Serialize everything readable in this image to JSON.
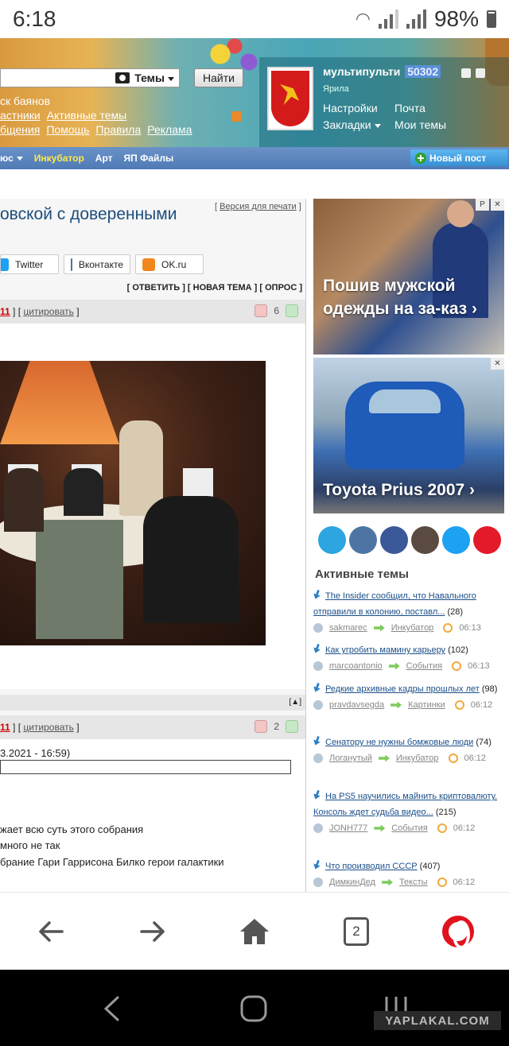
{
  "status_bar": {
    "time": "6:18",
    "battery": "98%"
  },
  "header": {
    "search": {
      "scope": "Темы",
      "button": "Найти"
    },
    "links_line1": "ск баянов",
    "links_line2": [
      "астники",
      "Активные темы"
    ],
    "links_line3": [
      "бщения",
      "Помощь",
      "Правила",
      "Реклама"
    ],
    "user": {
      "name": "мультипульти",
      "count": "50302",
      "rank": "Ярила",
      "links": {
        "settings": "Настройки",
        "mail": "Почта",
        "bookmarks": "Закладки",
        "my_topics": "Мои темы"
      }
    }
  },
  "nav": {
    "items": [
      "юс",
      "Инкубатор",
      "Арт",
      "ЯП Файлы"
    ],
    "new_post": "Новый пост",
    "accent": "#ffe94a"
  },
  "topic": {
    "title": "овской с доверенными",
    "print": "Версия для печати",
    "share": [
      "Twitter",
      "Вконтакте",
      "OK.ru"
    ],
    "actions": [
      "ОТВЕТИТЬ",
      "НОВАЯ ТЕМА",
      "ОПРОС"
    ],
    "post1": {
      "num": "11",
      "cite": "цитировать",
      "rating": "6"
    },
    "post2": {
      "num": "11",
      "cite": "цитировать",
      "rating": "2",
      "edited": "3.2021 - 16:59)",
      "lines": [
        "жает всю суть этого собрания",
        "много не так",
        "брание Гари Гаррисона Билко герои галактики"
      ]
    }
  },
  "ads": [
    {
      "text": "Пошив мужской одежды на за-каз ›"
    },
    {
      "text": "Toyota Prius 2007 ›"
    }
  ],
  "ad_controls": [
    "P",
    "✕"
  ],
  "socials": [
    {
      "name": "telegram-icon",
      "color": "#2ca5e0"
    },
    {
      "name": "vk-icon",
      "color": "#4c75a3"
    },
    {
      "name": "facebook-icon",
      "color": "#3b5998"
    },
    {
      "name": "instagram-icon",
      "color": "#5a4a42"
    },
    {
      "name": "twitter-icon",
      "color": "#1da1f2"
    },
    {
      "name": "zen-icon",
      "color": "#e4192a"
    }
  ],
  "active_topics": {
    "title": "Активные темы",
    "items": [
      {
        "title": "The Insider сообщил, что Навального отправили в колонию, поставл...",
        "count": "(28)",
        "user": "sakmarec",
        "section": "Инкубатор",
        "time": "06:13"
      },
      {
        "title": "Как угробить мамину карьеру",
        "count": "(102)",
        "user": "marcoantonio",
        "section": "События",
        "time": "06:13"
      },
      {
        "title": "Редкие архивные кадры прошлых лет",
        "count": "(98)",
        "user": "pravdavsegda",
        "section": "Картинки",
        "time": "06:12"
      },
      {
        "title": "Сенатору не нужны бомжовые люди",
        "count": "(74)",
        "user": "Логанутый",
        "section": "Инкубатор",
        "time": "06:12"
      },
      {
        "title": "На PS5 научились майнить криптовалюту. Консоль ждет судьба видео...",
        "count": "(215)",
        "user": "JONH777",
        "section": "События",
        "time": "06:12"
      },
      {
        "title": "Что производил СССР",
        "count": "(407)",
        "user": "ДимкинДед",
        "section": "Тексты",
        "time": "06:12"
      }
    ]
  },
  "browser": {
    "tabs_count": "2"
  },
  "watermark": "YAPLAKAL.COM"
}
